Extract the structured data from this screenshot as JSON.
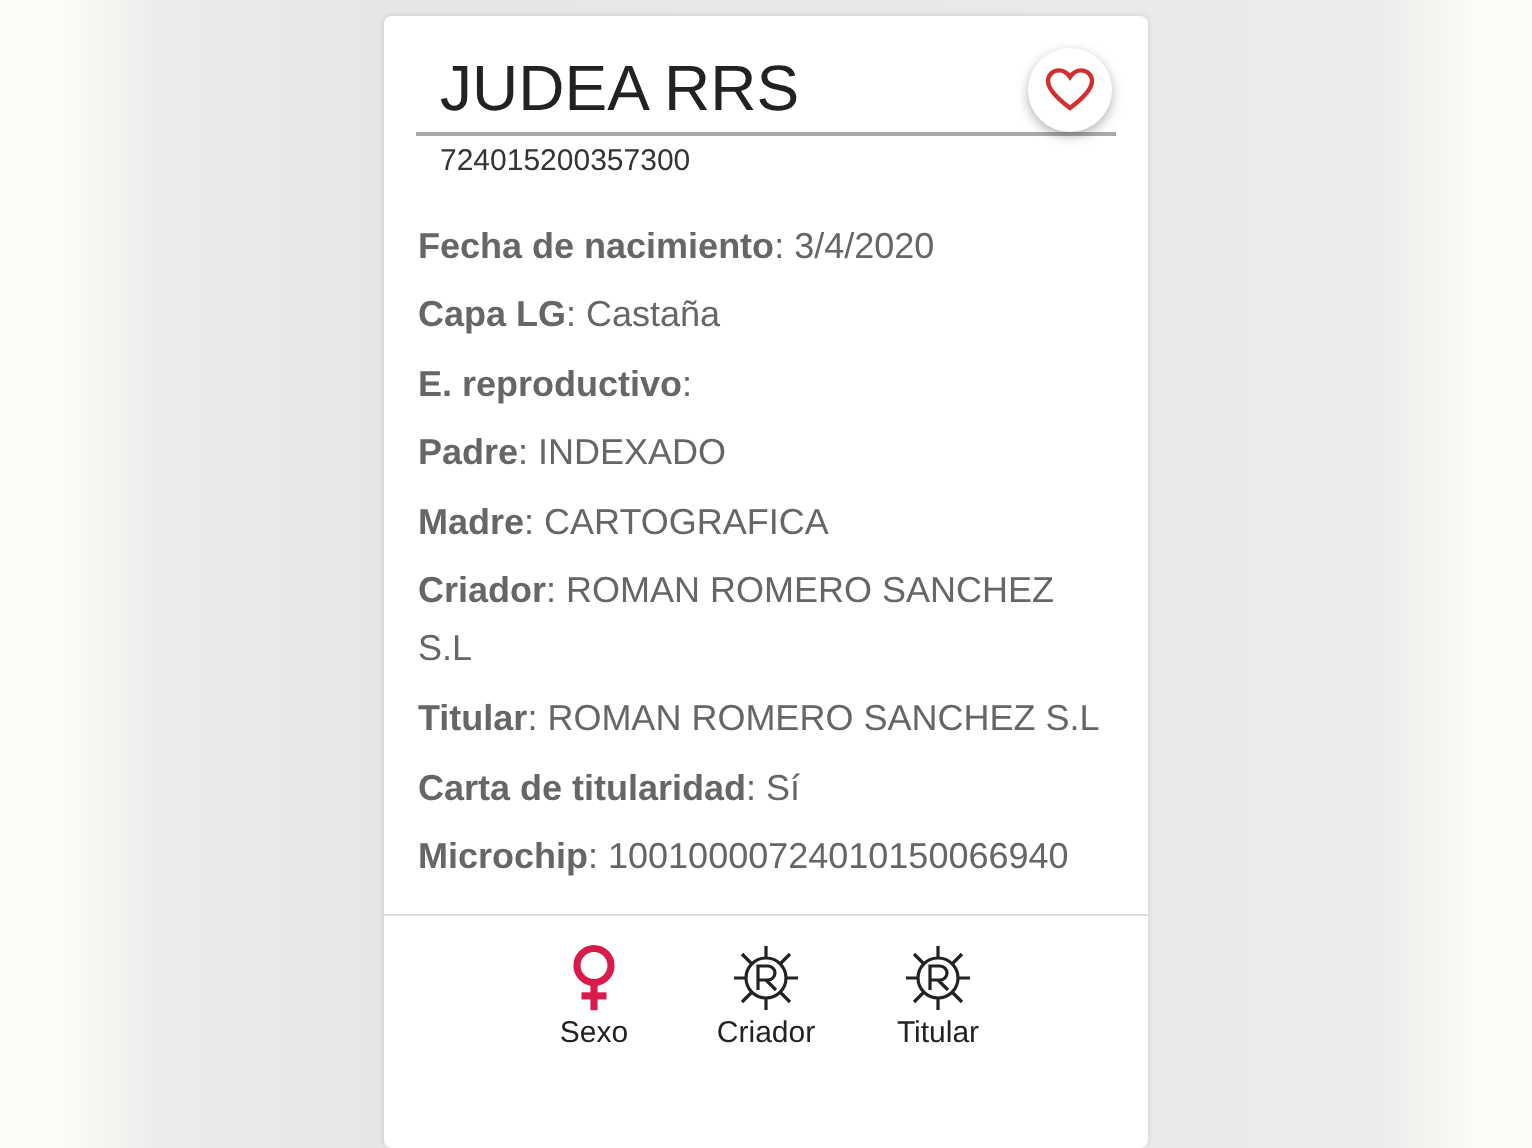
{
  "horse": {
    "name": "JUDEA RRS",
    "registration": "724015200357300"
  },
  "fields": [
    {
      "text": "**Fecha de nacimiento**: 3/4/2020"
    },
    {
      "text": "**Capa LG**: Castaña"
    },
    {
      "text": "**E. reproductivo**:"
    },
    {
      "text": "**Padre**: INDEXADO"
    },
    {
      "text": "**Madre**: CARTOGRAFICA"
    },
    {
      "text": "**Criador**: ROMAN ROMERO SANCHEZ S.L"
    },
    {
      "text": "**Titular**: ROMAN ROMERO SANCHEZ S.L"
    },
    {
      "text": "**Carta de titularidad**: Sí"
    },
    {
      "text": "**Microchip**: 10010000724010150066940"
    }
  ],
  "footer": [
    {
      "kind": "female",
      "label": "Sexo"
    },
    {
      "kind": "registered",
      "label": "Criador"
    },
    {
      "kind": "registered",
      "label": "Titular"
    }
  ]
}
